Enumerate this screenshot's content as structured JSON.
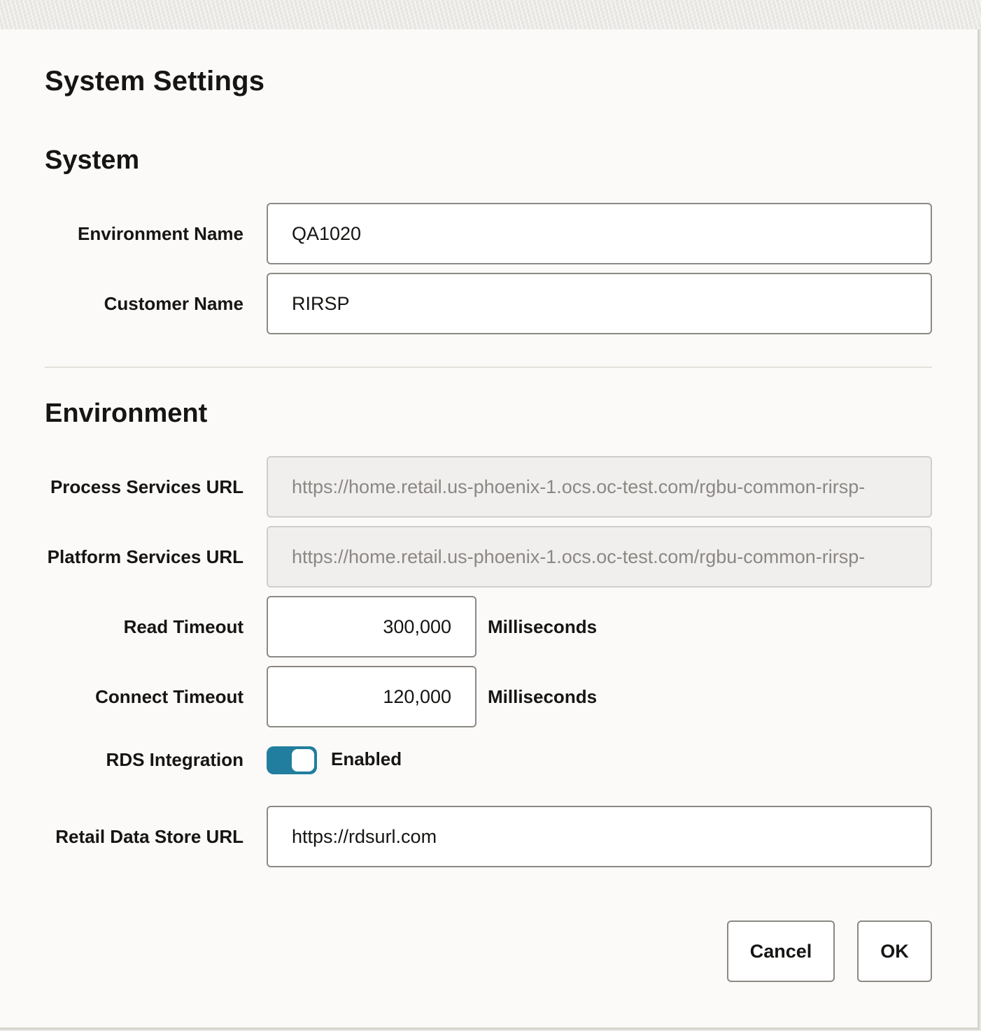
{
  "dialog": {
    "title": "System Settings"
  },
  "system_section": {
    "title": "System",
    "environment_name": {
      "label": "Environment Name",
      "value": "QA1020"
    },
    "customer_name": {
      "label": "Customer Name",
      "value": "RIRSP"
    }
  },
  "environment_section": {
    "title": "Environment",
    "process_services_url": {
      "label": "Process Services URL",
      "value": "https://home.retail.us-phoenix-1.ocs.oc-test.com/rgbu-common-rirsp-"
    },
    "platform_services_url": {
      "label": "Platform Services URL",
      "value": "https://home.retail.us-phoenix-1.ocs.oc-test.com/rgbu-common-rirsp-"
    },
    "read_timeout": {
      "label": "Read Timeout",
      "value": "300,000",
      "unit": "Milliseconds"
    },
    "connect_timeout": {
      "label": "Connect Timeout",
      "value": "120,000",
      "unit": "Milliseconds"
    },
    "rds_integration": {
      "label": "RDS Integration",
      "state_label": "Enabled",
      "enabled": true
    },
    "retail_data_store_url": {
      "label": "Retail Data Store URL",
      "value": "https://rdsurl.com"
    }
  },
  "buttons": {
    "cancel_label": "Cancel",
    "ok_label": "OK"
  },
  "colors": {
    "toggle_on": "#227e9e",
    "dialog_background": "#fcfaf9",
    "readonly_background": "#f1efed"
  }
}
